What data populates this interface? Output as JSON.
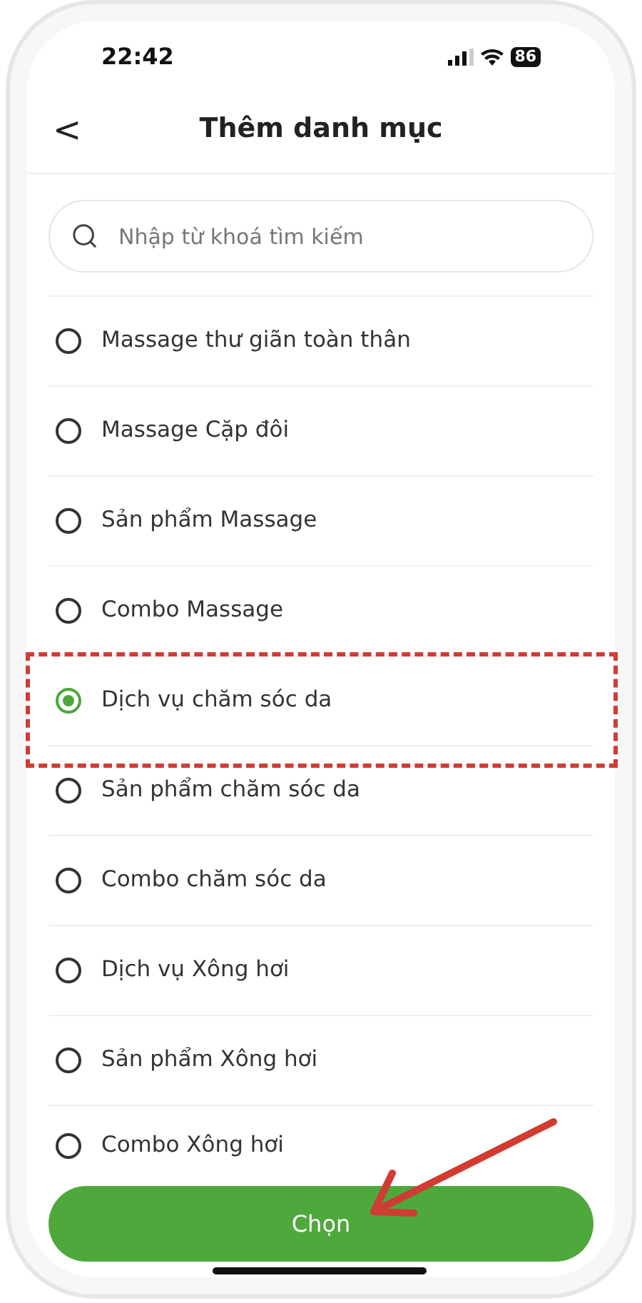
{
  "status_bar": {
    "time": "22:42",
    "battery": "86"
  },
  "header": {
    "back": "<",
    "title": "Thêm danh mục"
  },
  "search": {
    "placeholder": "Nhập từ khoá tìm kiếm"
  },
  "options": [
    {
      "label": "Massage thư giãn toàn thân",
      "selected": false
    },
    {
      "label": "Massage Cặp đôi",
      "selected": false
    },
    {
      "label": "Sản phẩm Massage",
      "selected": false
    },
    {
      "label": "Combo Massage",
      "selected": false
    },
    {
      "label": "Dịch vụ chăm sóc da",
      "selected": true
    },
    {
      "label": "Sản phẩm chăm sóc da",
      "selected": false
    },
    {
      "label": "Combo chăm sóc da",
      "selected": false
    },
    {
      "label": "Dịch vụ Xông hơi",
      "selected": false
    },
    {
      "label": "Sản phẩm Xông hơi",
      "selected": false
    },
    {
      "label": "Combo Xông hơi",
      "selected": false
    }
  ],
  "button": "Chọn"
}
